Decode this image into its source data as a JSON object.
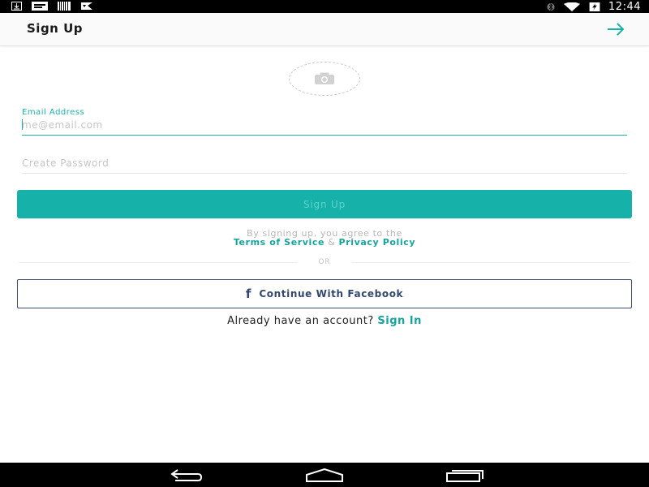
{
  "status_bar": {
    "time": "12:44",
    "left_icons": [
      "download-icon",
      "message-icon",
      "barcode-icon",
      "signal-flag-icon"
    ],
    "right_icons": [
      "bluetooth-icon",
      "wifi-icon",
      "battery-charging-icon"
    ]
  },
  "header": {
    "title": "Sign Up",
    "next_icon": "arrow-right-icon"
  },
  "avatar": {
    "icon": "camera-icon"
  },
  "email": {
    "label": "Email Address",
    "placeholder": "me@email.com",
    "value": ""
  },
  "password": {
    "placeholder": "Create Password",
    "value": ""
  },
  "signup_button": {
    "label": "Sign Up"
  },
  "terms": {
    "line1": "By signing up, you agree to the",
    "terms_link": "Terms of Service",
    "ampersand": "&",
    "privacy_link": "Privacy Policy"
  },
  "divider": {
    "label": "OR"
  },
  "facebook_button": {
    "icon": "f",
    "label": "Continue With Facebook"
  },
  "signin": {
    "prompt": "Already have an account?",
    "link": "Sign In"
  },
  "nav_bar": {
    "buttons": [
      "back-icon",
      "home-icon",
      "recents-icon"
    ]
  },
  "colors": {
    "accent": "#16b2aa",
    "facebook": "#33486f",
    "status_bar": "#000000"
  }
}
